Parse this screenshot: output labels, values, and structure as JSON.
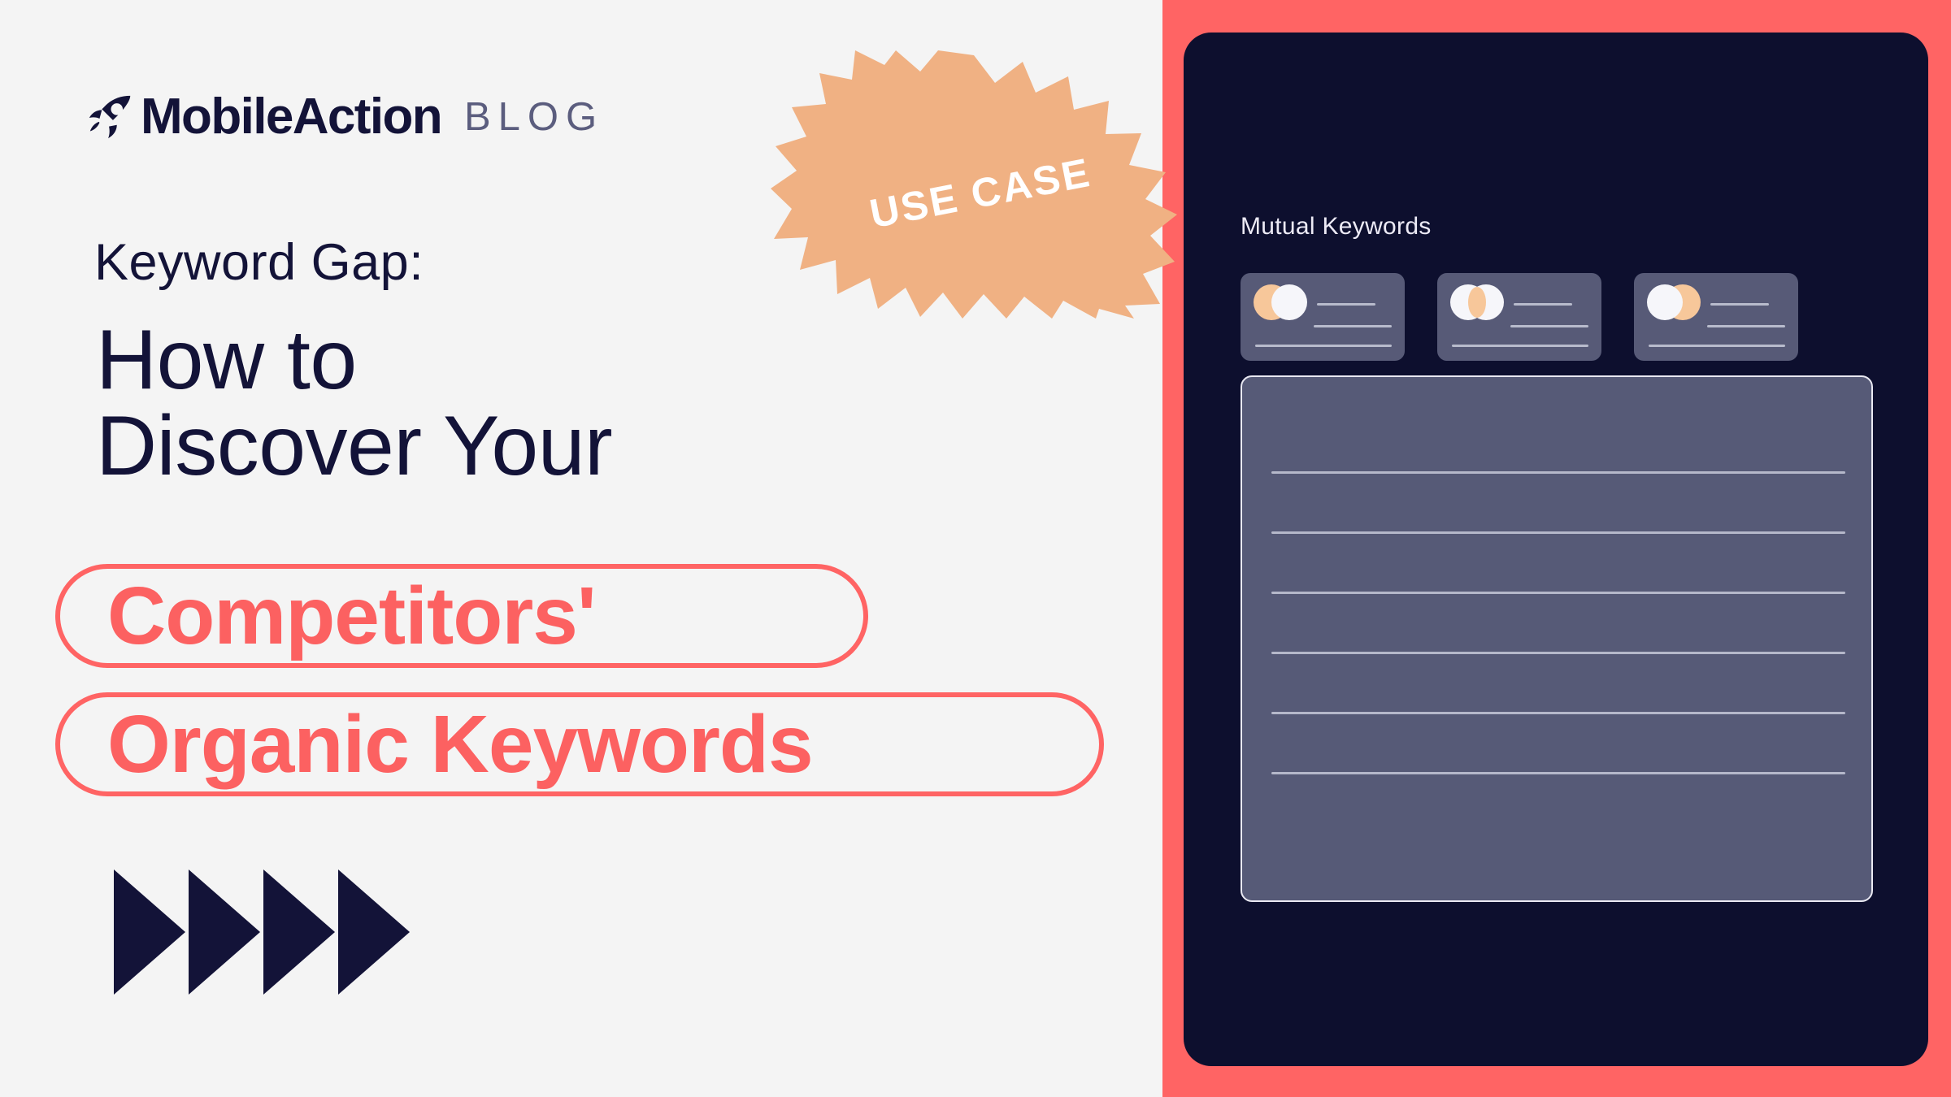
{
  "brand": {
    "logo_icon": "rocket-icon",
    "wordmark": "MobileAction",
    "section": "BLOG",
    "navy": "#131338",
    "coral": "#ff6464",
    "badge_orange": "#f0b183",
    "light_bg": "#f4f4f4",
    "panel_navy": "#0d0f2e",
    "card_slate": "#575a77"
  },
  "badge": {
    "label": "USE CASE",
    "shape": "starburst",
    "rotation_deg": -11
  },
  "hero": {
    "eyebrow": "Keyword Gap:",
    "headline": "How  to\nDiscover Your",
    "pill_1": "Competitors'",
    "pill_2": "Organic Keywords",
    "arrow_count": 4,
    "arrow_icon": "chevron-right-triangle-icon"
  },
  "mockup": {
    "title": "Mutual Keywords",
    "cards": [
      {
        "venn_icon": "venn-diagram-icon",
        "variant": "orange-behind-white"
      },
      {
        "venn_icon": "venn-diagram-icon",
        "variant": "white-white-orange-lens"
      },
      {
        "venn_icon": "venn-diagram-icon",
        "variant": "white-over-orange"
      }
    ],
    "table": {
      "row_count": 6,
      "rule_offsets": [
        116,
        190,
        264,
        338,
        412,
        486
      ]
    }
  }
}
